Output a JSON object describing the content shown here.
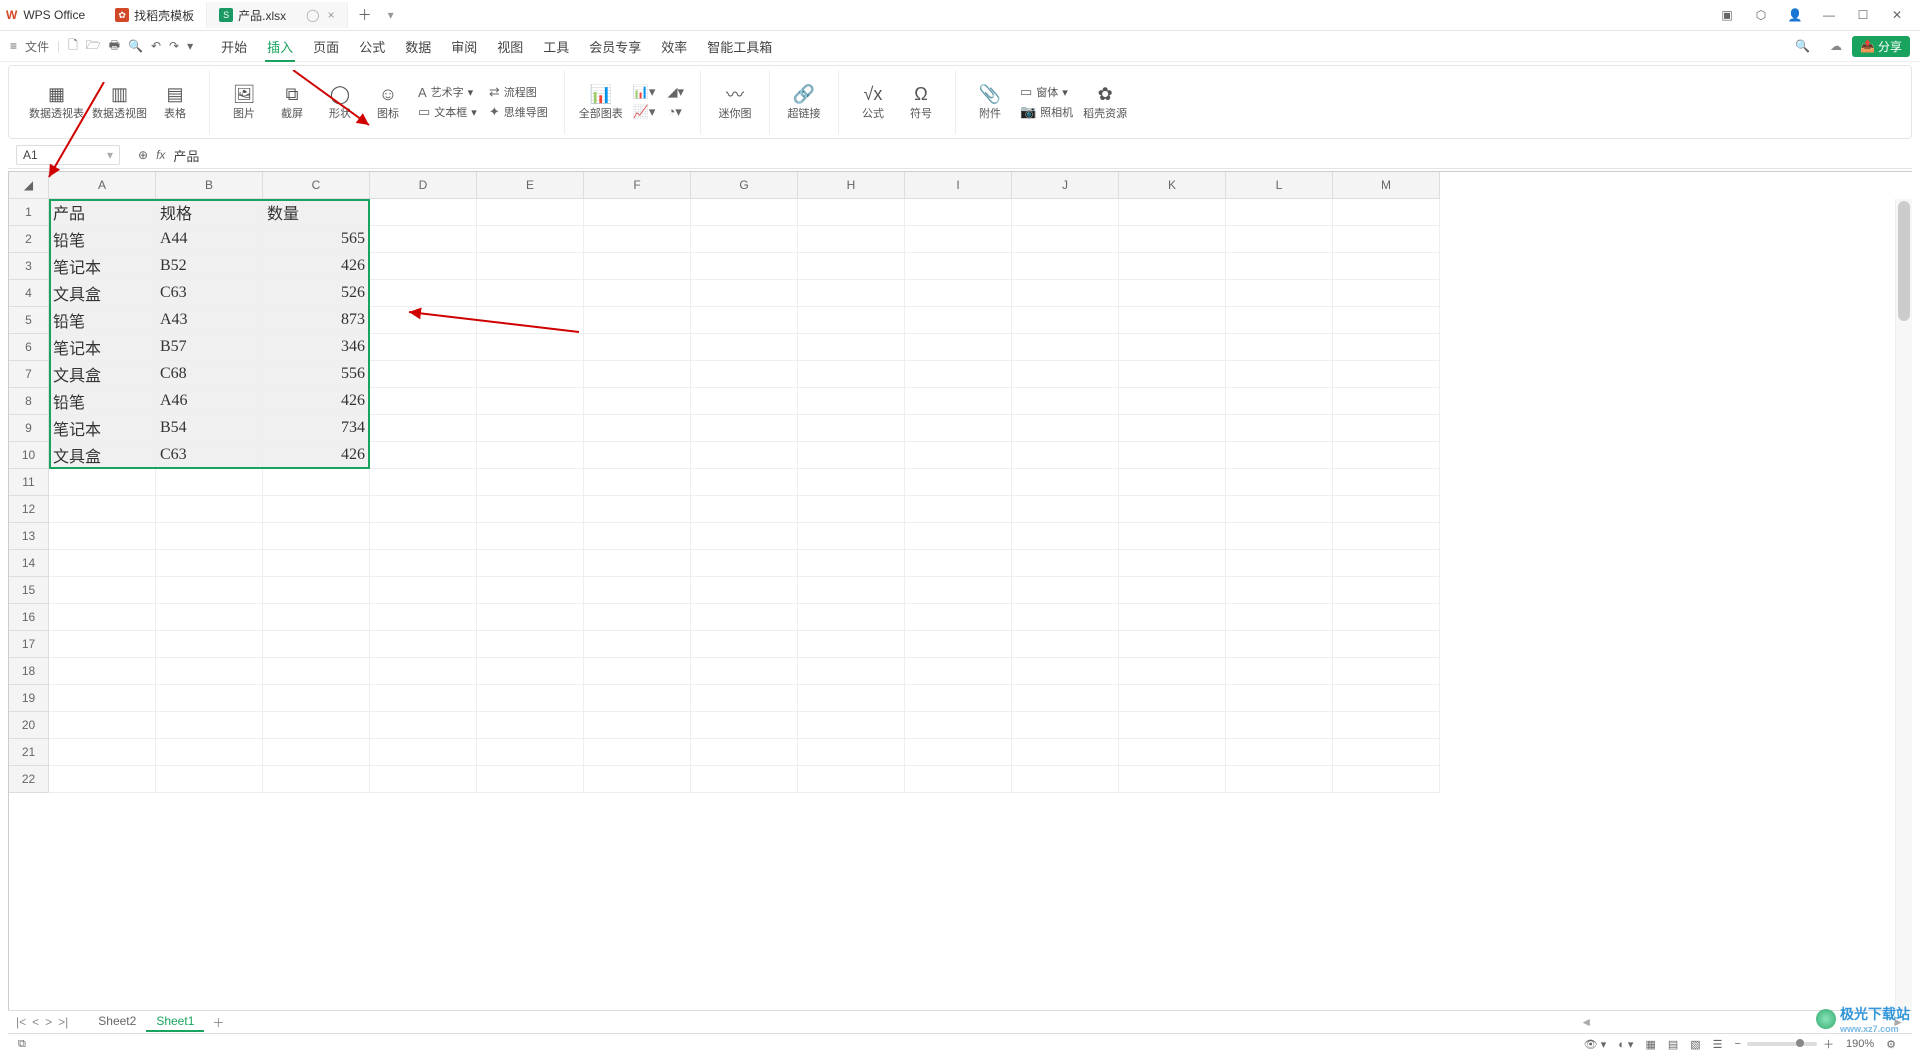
{
  "app": {
    "name": "WPS Office"
  },
  "tabs": [
    {
      "icon": "red",
      "iconText": "✿",
      "label": "找稻壳模板"
    },
    {
      "icon": "green",
      "iconText": "S",
      "label": "产品.xlsx",
      "active": true,
      "closeable": true
    }
  ],
  "menu": {
    "fileLabel": "文件",
    "items": [
      "开始",
      "插入",
      "页面",
      "公式",
      "数据",
      "审阅",
      "视图",
      "工具",
      "会员专享",
      "效率",
      "智能工具箱"
    ],
    "activeIndex": 1,
    "shareLabel": "分享"
  },
  "ribbon": {
    "g1": [
      "数据透视表",
      "数据透视图",
      "表格"
    ],
    "g2": {
      "img": "图片",
      "crop": "截屏",
      "shape": "形状",
      "icon": "图标",
      "art": "艺术字",
      "textbox": "文本框",
      "flow": "流程图",
      "mind": "思维导图"
    },
    "g3": {
      "all": "全部图表"
    },
    "g4": {
      "spark": "迷你图"
    },
    "g5": {
      "link": "超链接"
    },
    "g6": {
      "formula": "公式",
      "symbol": "符号"
    },
    "g7": {
      "attach": "附件",
      "camera": "照相机",
      "res": "稻壳资源",
      "form": "窗体"
    }
  },
  "namebox": {
    "cell": "A1",
    "formula": "产品"
  },
  "columns": [
    "A",
    "B",
    "C",
    "D",
    "E",
    "F",
    "G",
    "H",
    "I",
    "J",
    "K",
    "L",
    "M"
  ],
  "rowCount": 22,
  "selection": {
    "colStart": 0,
    "colEnd": 2,
    "rowStart": 0,
    "rowEnd": 9
  },
  "data": [
    {
      "A": "产品",
      "B": "规格",
      "C": "数量",
      "Cnum": false
    },
    {
      "A": "铅笔",
      "B": "A44",
      "C": "565",
      "Cnum": true
    },
    {
      "A": "笔记本",
      "B": "B52",
      "C": "426",
      "Cnum": true
    },
    {
      "A": "文具盒",
      "B": "C63",
      "C": "526",
      "Cnum": true
    },
    {
      "A": "铅笔",
      "B": "A43",
      "C": "873",
      "Cnum": true
    },
    {
      "A": "笔记本",
      "B": "B57",
      "C": "346",
      "Cnum": true
    },
    {
      "A": "文具盒",
      "B": "C68",
      "C": "556",
      "Cnum": true
    },
    {
      "A": "铅笔",
      "B": "A46",
      "C": "426",
      "Cnum": true
    },
    {
      "A": "笔记本",
      "B": "B54",
      "C": "734",
      "Cnum": true
    },
    {
      "A": "文具盒",
      "B": "C63",
      "C": "426",
      "Cnum": true
    }
  ],
  "sheets": {
    "list": [
      "Sheet2",
      "Sheet1"
    ],
    "active": 1
  },
  "status": {
    "zoom": "190%"
  },
  "watermark": {
    "text": "极光下载站",
    "sub": "www.xz7.com"
  }
}
